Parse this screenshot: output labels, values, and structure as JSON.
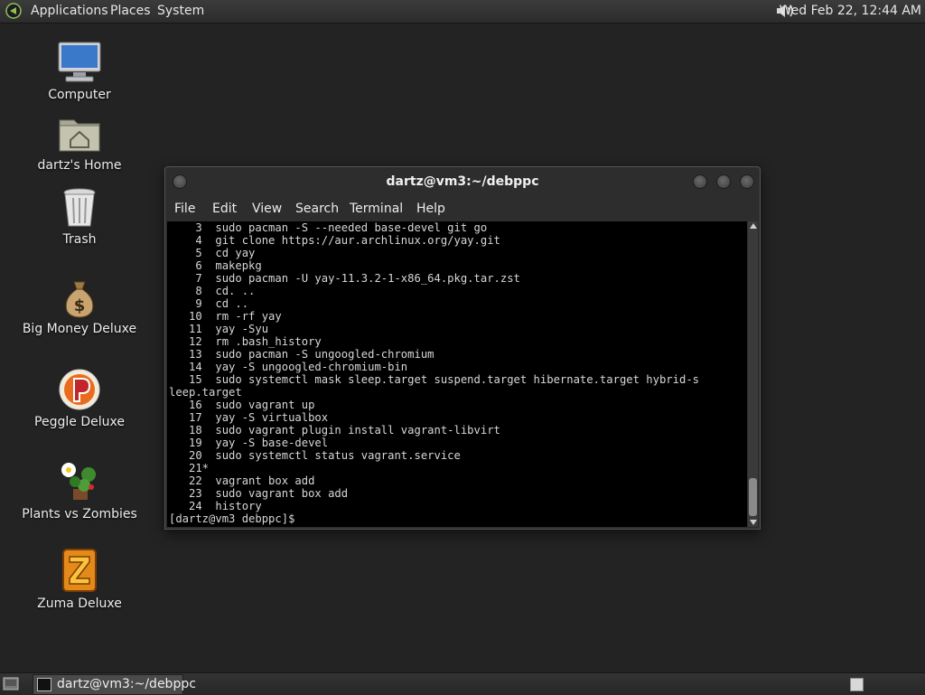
{
  "top_panel": {
    "menus": [
      "Applications",
      "Places",
      "System"
    ],
    "clock": "Wed Feb 22, 12:44 AM"
  },
  "desktop_icons": [
    {
      "label": "Computer",
      "icon": "computer-icon"
    },
    {
      "label": "dartz's Home",
      "icon": "home-folder-icon"
    },
    {
      "label": "Trash",
      "icon": "trash-icon"
    },
    {
      "label": "Big Money Deluxe",
      "icon": "money-bag-icon"
    },
    {
      "label": "Peggle Deluxe",
      "icon": "peggle-icon"
    },
    {
      "label": "Plants vs Zombies",
      "icon": "plants-vs-zombies-icon"
    },
    {
      "label": "Zuma Deluxe",
      "icon": "zuma-icon"
    }
  ],
  "terminal": {
    "title": "dartz@vm3:~/debppc",
    "menu": [
      "File",
      "Edit",
      "View",
      "Search",
      "Terminal",
      "Help"
    ],
    "lines": [
      "    3  sudo pacman -S --needed base-devel git go",
      "    4  git clone https://aur.archlinux.org/yay.git",
      "    5  cd yay",
      "    6  makepkg",
      "    7  sudo pacman -U yay-11.3.2-1-x86_64.pkg.tar.zst",
      "    8  cd. ..",
      "    9  cd ..",
      "   10  rm -rf yay",
      "   11  yay -Syu",
      "   12  rm .bash_history",
      "   13  sudo pacman -S ungoogled-chromium",
      "   14  yay -S ungoogled-chromium-bin",
      "   15  sudo systemctl mask sleep.target suspend.target hibernate.target hybrid-s",
      "leep.target",
      "   16  sudo vagrant up",
      "   17  yay -S virtualbox",
      "   18  sudo vagrant plugin install vagrant-libvirt",
      "   19  yay -S base-devel",
      "   20  sudo systemctl status vagrant.service",
      "   21*",
      "   22  vagrant box add",
      "   23  sudo vagrant box add",
      "   24  history",
      "[dartz@vm3 debppc]$ "
    ]
  },
  "taskbar": {
    "window_button": "dartz@vm3:~/debppc"
  }
}
